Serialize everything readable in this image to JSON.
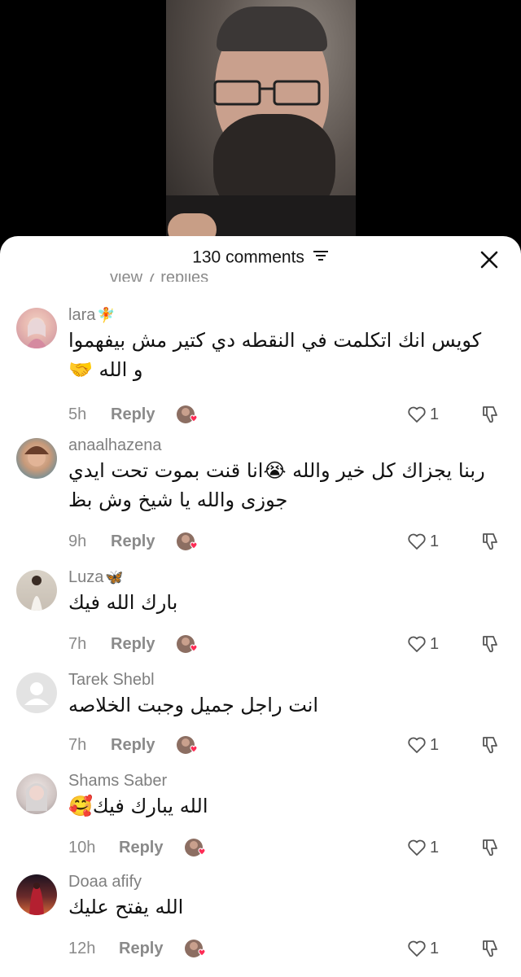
{
  "header": {
    "comment_count": "130 comments"
  },
  "partial_text": "view 7 replies",
  "comments": [
    {
      "username": "lara",
      "user_emoji": "🧚",
      "lines": [
        "كويس انك اتكلمت في النقطه دي كتير مش بيفهموا",
        "و الله 🤝"
      ],
      "time": "5h",
      "reply_label": "Reply",
      "likes": "1"
    },
    {
      "username": "anaalhazena",
      "user_emoji": "",
      "lines": [
        "ربنا يجزاك كل خير والله 😭انا قنت بموت تحت ايدي",
        "جوزى والله يا شيخ وش بظ"
      ],
      "time": "9h",
      "reply_label": "Reply",
      "likes": "1"
    },
    {
      "username": "Luza",
      "user_emoji": "🦋",
      "lines": [
        "بارك الله فيك"
      ],
      "time": "7h",
      "reply_label": "Reply",
      "likes": "1"
    },
    {
      "username": "Tarek Shebl",
      "user_emoji": "",
      "lines": [
        "انت راجل جميل وجبت الخلاصه"
      ],
      "time": "7h",
      "reply_label": "Reply",
      "likes": "1"
    },
    {
      "username": "Shams Saber",
      "user_emoji": "",
      "lines": [
        "الله يبارك فيك🥰"
      ],
      "time": "10h",
      "reply_label": "Reply",
      "likes": "1"
    },
    {
      "username": "Doaa afify",
      "user_emoji": "",
      "lines": [
        "الله يفتح عليك"
      ],
      "time": "12h",
      "reply_label": "Reply",
      "likes": "1"
    }
  ],
  "icons": {
    "filter": "filter-icon",
    "close": "close-icon",
    "like": "heart-outline-icon",
    "dislike": "thumbs-down-icon",
    "creator_liked": "creator-liked-badge"
  },
  "colors": {
    "heart_badge": "#fe2c55",
    "meta_text": "#8a8a8a"
  }
}
